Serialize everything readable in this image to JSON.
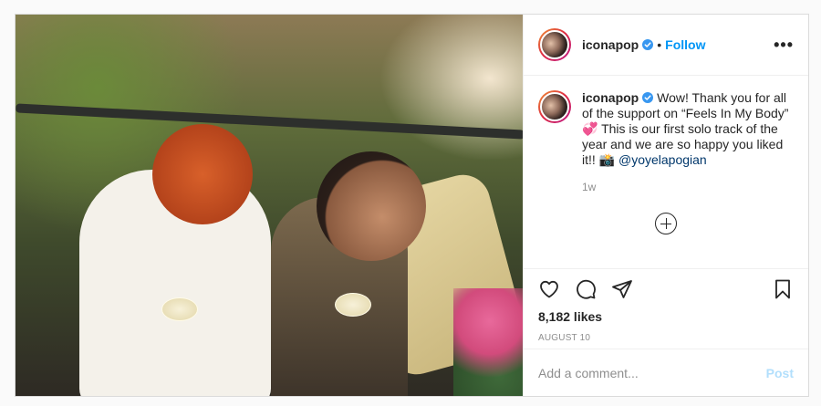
{
  "post": {
    "author": "iconapop",
    "follow_label": "Follow",
    "separator": "•",
    "more_label": "•••",
    "caption": {
      "username": "iconapop",
      "text": " Wow! Thank you for all of the support on “Feels In My Body” 💞 This is our first solo track of the year and we are so happy you liked it!! 📸 ",
      "mention": "@yoyelapogian"
    },
    "time_ago": "1w",
    "likes": "8,182 likes",
    "date": "AUGUST 10",
    "comment_placeholder": "Add a comment...",
    "post_label": "Post"
  },
  "icons": {
    "verified": "verified-badge-icon",
    "like": "heart-icon",
    "comment": "comment-bubble-icon",
    "share": "paper-plane-icon",
    "save": "bookmark-icon",
    "load_more": "circle-plus-icon",
    "more": "more-options-icon"
  },
  "colors": {
    "accent": "#0095f6",
    "verified": "#3897f0",
    "post_disabled": "#b2dffc",
    "muted": "#8e8e8e"
  }
}
